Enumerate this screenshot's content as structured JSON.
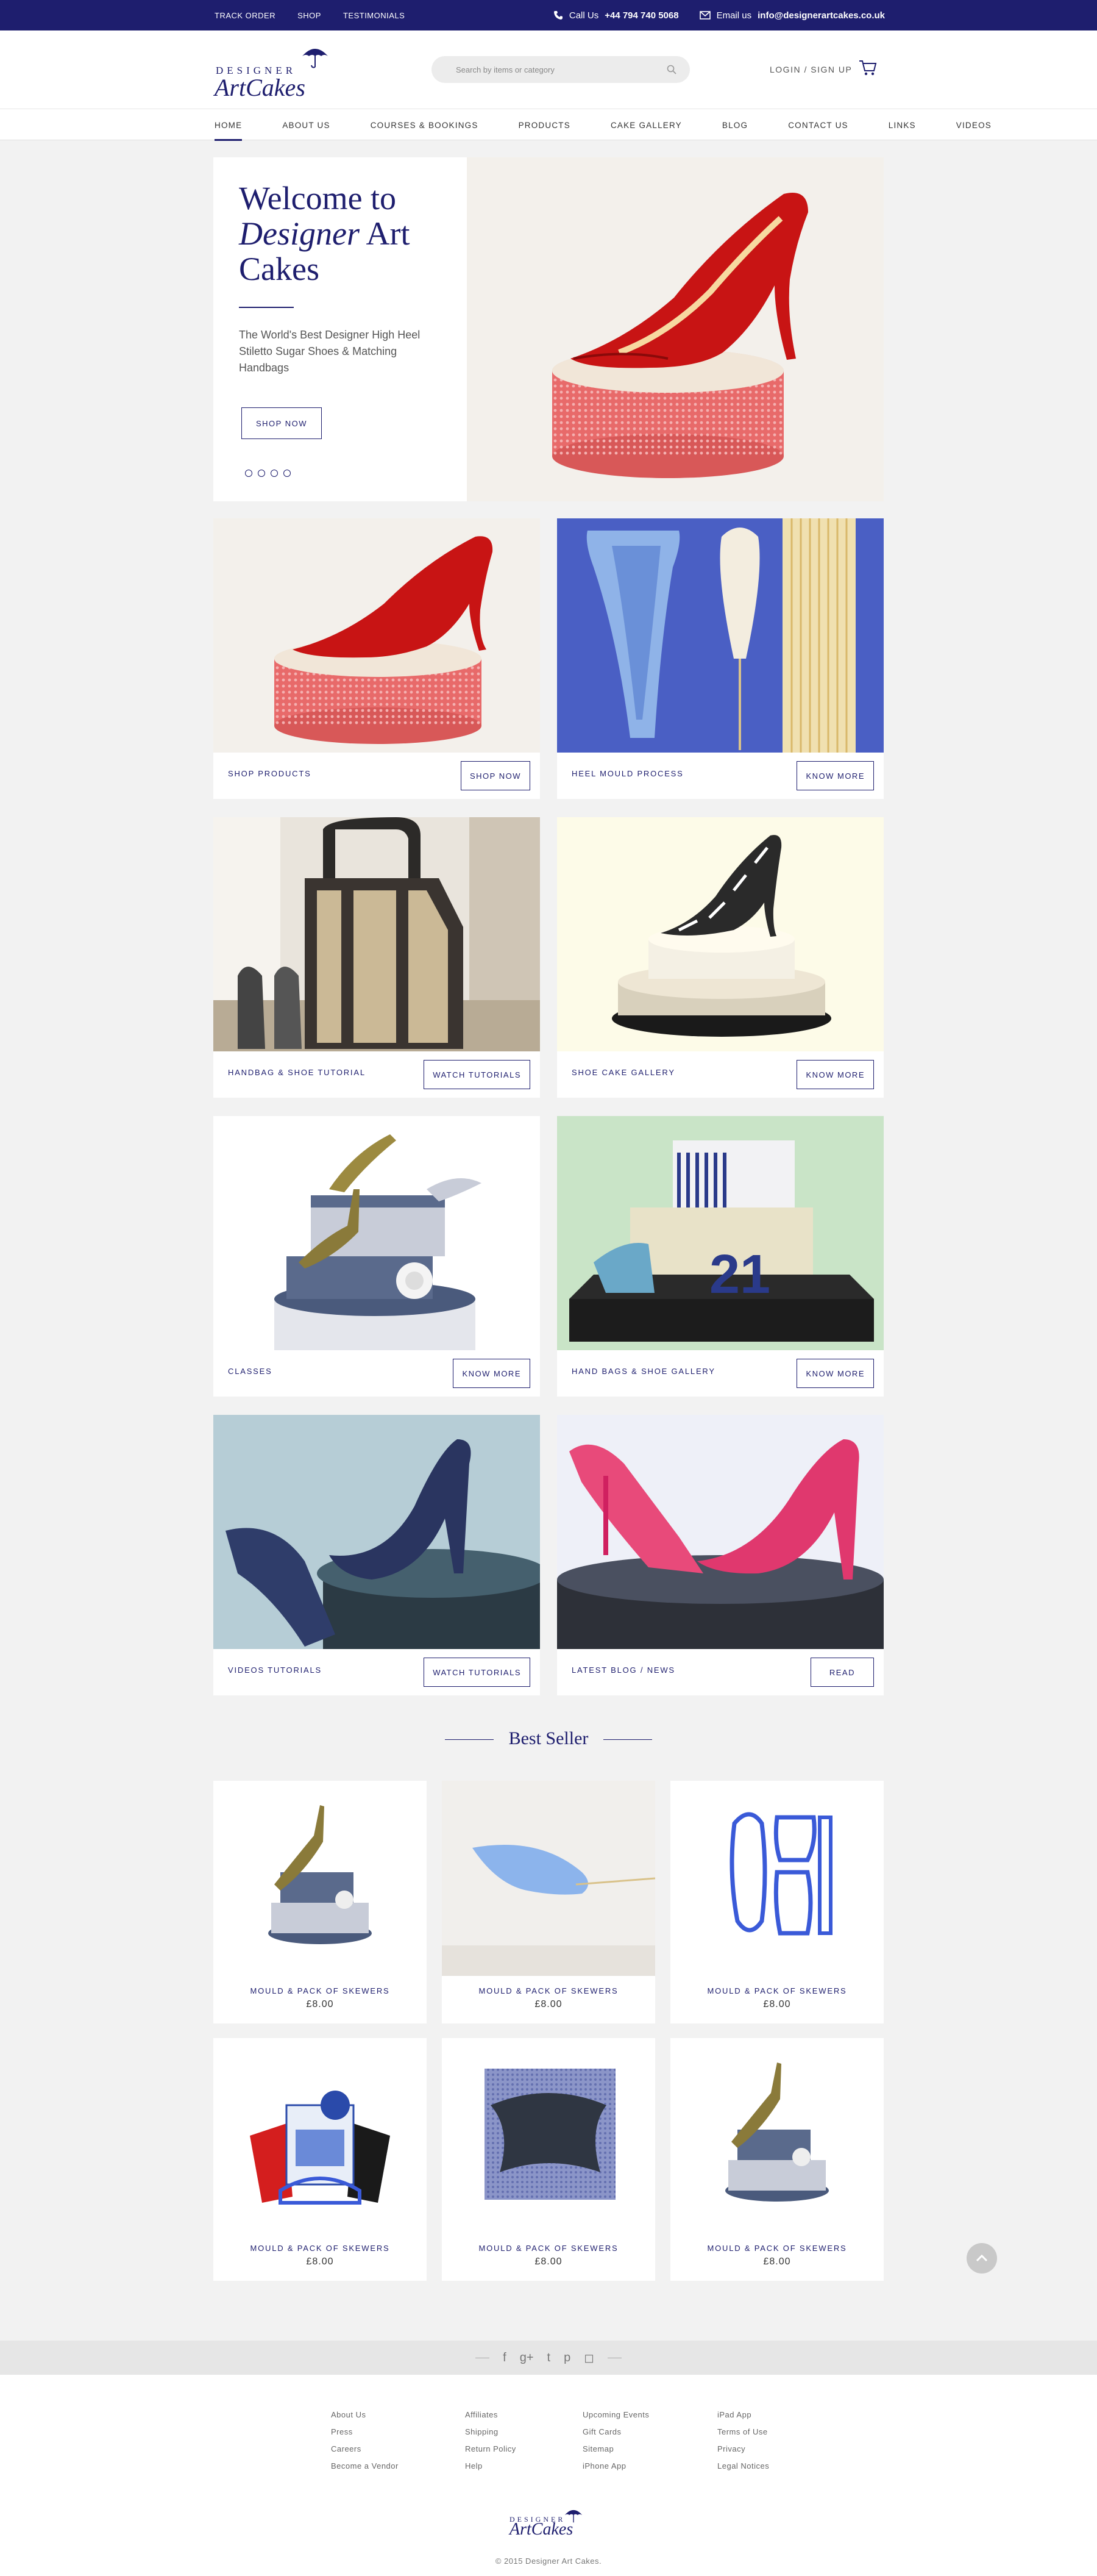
{
  "topbar": {
    "links": [
      "TRACK ORDER",
      "SHOP",
      "TESTIMONIALS"
    ],
    "call_label": "Call Us",
    "phone": "+44 794 740 5068",
    "email_label": "Email us",
    "email": "info@designerartcakes.co.uk"
  },
  "header": {
    "logo_top": "DESIGNER",
    "logo_art": "Art",
    "logo_cakes": "Cakes",
    "search_placeholder": "Search by items or category",
    "login": "LOGIN / SIGN UP"
  },
  "nav": [
    "HOME",
    "ABOUT US",
    "COURSES & BOOKINGS",
    "PRODUCTS",
    "CAKE GALLERY",
    "BLOG",
    "CONTACT US",
    "LINKS",
    "VIDEOS"
  ],
  "hero": {
    "title_1": "Welcome to",
    "title_2": "Designer",
    "title_3": "Art Cakes",
    "subtitle": "The World's Best Designer High Heel Stiletto Sugar Shoes & Matching Handbags",
    "button": "SHOP NOW"
  },
  "cards": [
    {
      "label": "SHOP PRODUCTS",
      "button": "SHOP NOW"
    },
    {
      "label": "HEEL MOULD PROCESS",
      "button": "KNOW MORE"
    },
    {
      "label": "HANDBAG & SHOE TUTORIAL",
      "button": "WATCH TUTORIALS"
    },
    {
      "label": "SHOE CAKE GALLERY",
      "button": "KNOW MORE"
    },
    {
      "label": "CLASSES",
      "button": "KNOW MORE"
    },
    {
      "label": "HAND BAGS & SHOE GALLERY",
      "button": "KNOW MORE"
    },
    {
      "label": "VIDEOS TUTORIALS",
      "button": "WATCH TUTORIALS"
    },
    {
      "label": "LATEST BLOG  / NEWS",
      "button": "READ"
    }
  ],
  "best_seller": {
    "title": "Best Seller",
    "products": [
      {
        "name": "MOULD & PACK OF SKEWERS",
        "price": "£8.00"
      },
      {
        "name": "MOULD & PACK OF SKEWERS",
        "price": "£8.00"
      },
      {
        "name": "MOULD & PACK OF SKEWERS",
        "price": "£8.00"
      },
      {
        "name": "MOULD & PACK OF SKEWERS",
        "price": "£8.00"
      },
      {
        "name": "MOULD & PACK OF SKEWERS",
        "price": "£8.00"
      },
      {
        "name": "MOULD & PACK OF SKEWERS",
        "price": "£8.00"
      }
    ]
  },
  "footer": {
    "col1": [
      "About Us",
      "Press",
      "Careers",
      "Become a Vendor"
    ],
    "col2": [
      "Affiliates",
      "Shipping",
      "Return Policy",
      "Help"
    ],
    "col3": [
      "Upcoming Events",
      "Gift Cards",
      "Sitemap",
      "iPhone App"
    ],
    "col4": [
      "iPad App",
      "Terms of Use",
      "Privacy",
      "Legal Notices"
    ],
    "copyright": "© 2015 Designer Art Cakes."
  },
  "colors": {
    "brand": "#1e1e6e",
    "background": "#f2f2f2"
  }
}
